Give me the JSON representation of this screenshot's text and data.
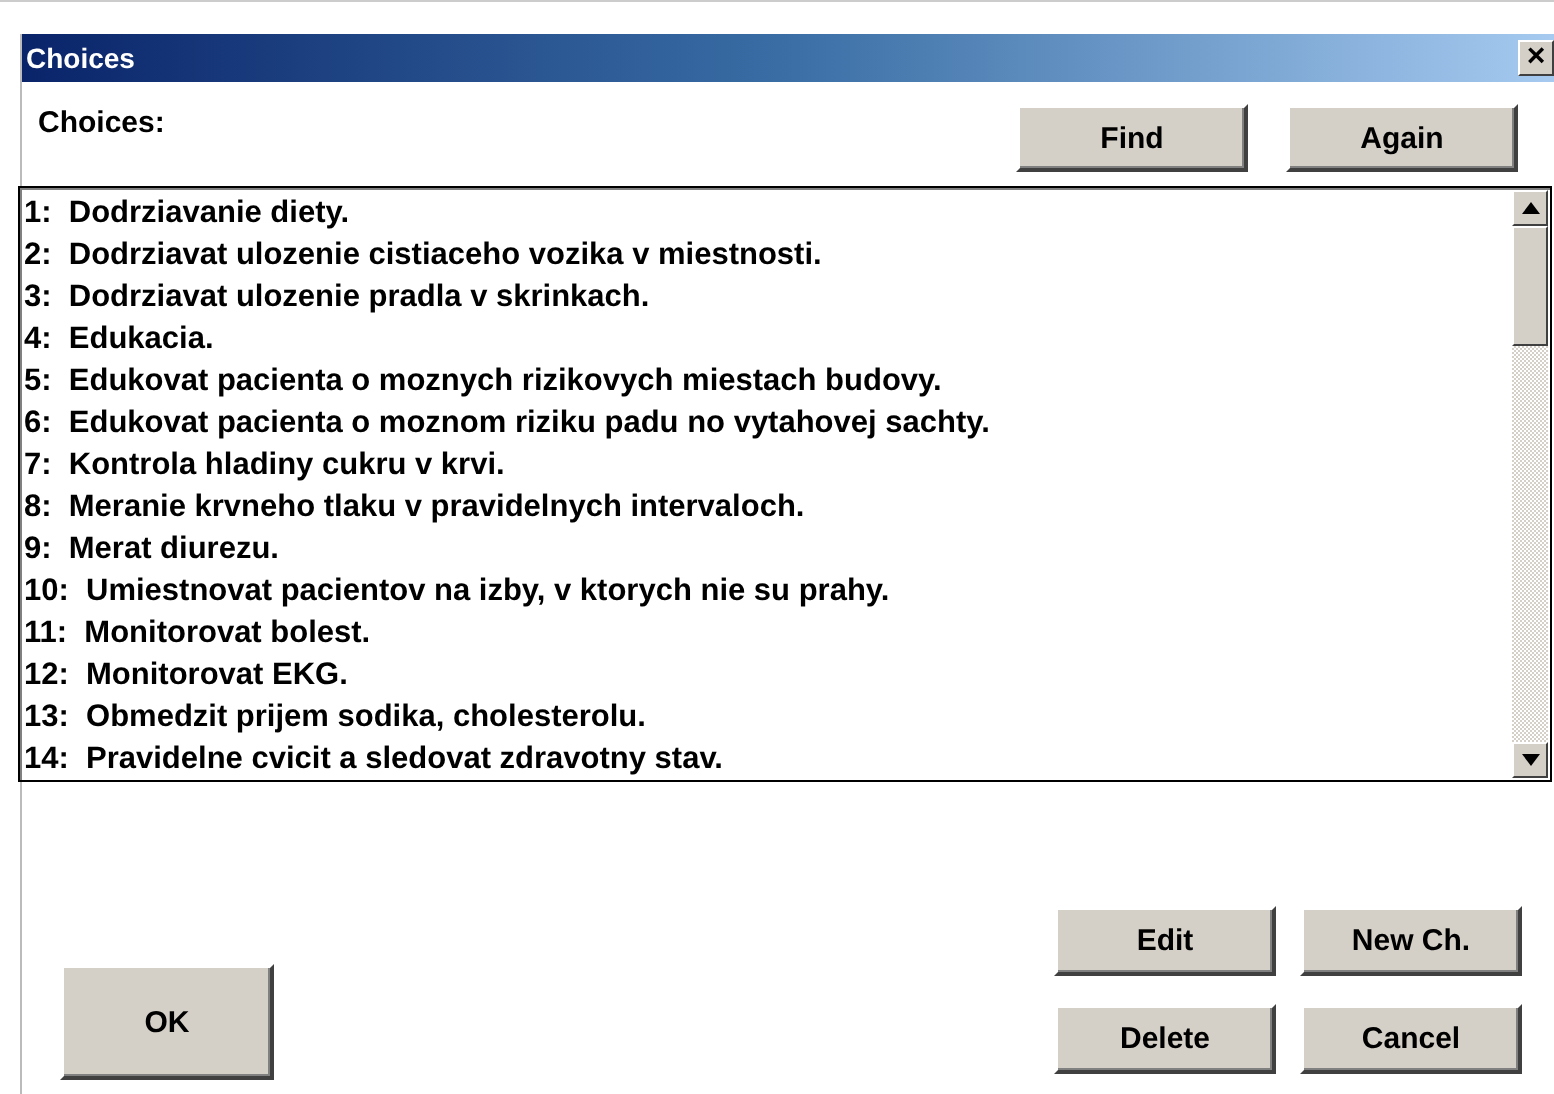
{
  "window": {
    "title": "Choices",
    "close": "×"
  },
  "label": "Choices:",
  "top_buttons": [
    "Find",
    "Again"
  ],
  "choices": [
    "1:  Dodrziavanie diety.",
    "2:  Dodrziavat ulozenie cistiaceho vozika v miestnosti.",
    "3:  Dodrziavat ulozenie pradla v skrinkach.",
    "4:  Edukacia.",
    "5:  Edukovat pacienta o moznych rizikovych miestach budovy.",
    "6:  Edukovat pacienta o moznom riziku padu no vytahovej sachty.",
    "7:  Kontrola hladiny cukru v krvi.",
    "8:  Meranie krvneho tlaku v pravidelnych intervaloch.",
    "9:  Merat diurezu.",
    "10:  Umiestnovat pacientov na izby, v ktorych nie su prahy.",
    "11:  Monitorovat bolest.",
    "12:  Monitorovat EKG.",
    "13:  Obmedzit prijem sodika, cholesterolu.",
    "14:  Pravidelne cvicit a sledovat zdravotny stav."
  ],
  "ok_button": "OK",
  "action_buttons": [
    "Edit",
    "New Ch.",
    "Delete",
    "Cancel"
  ]
}
